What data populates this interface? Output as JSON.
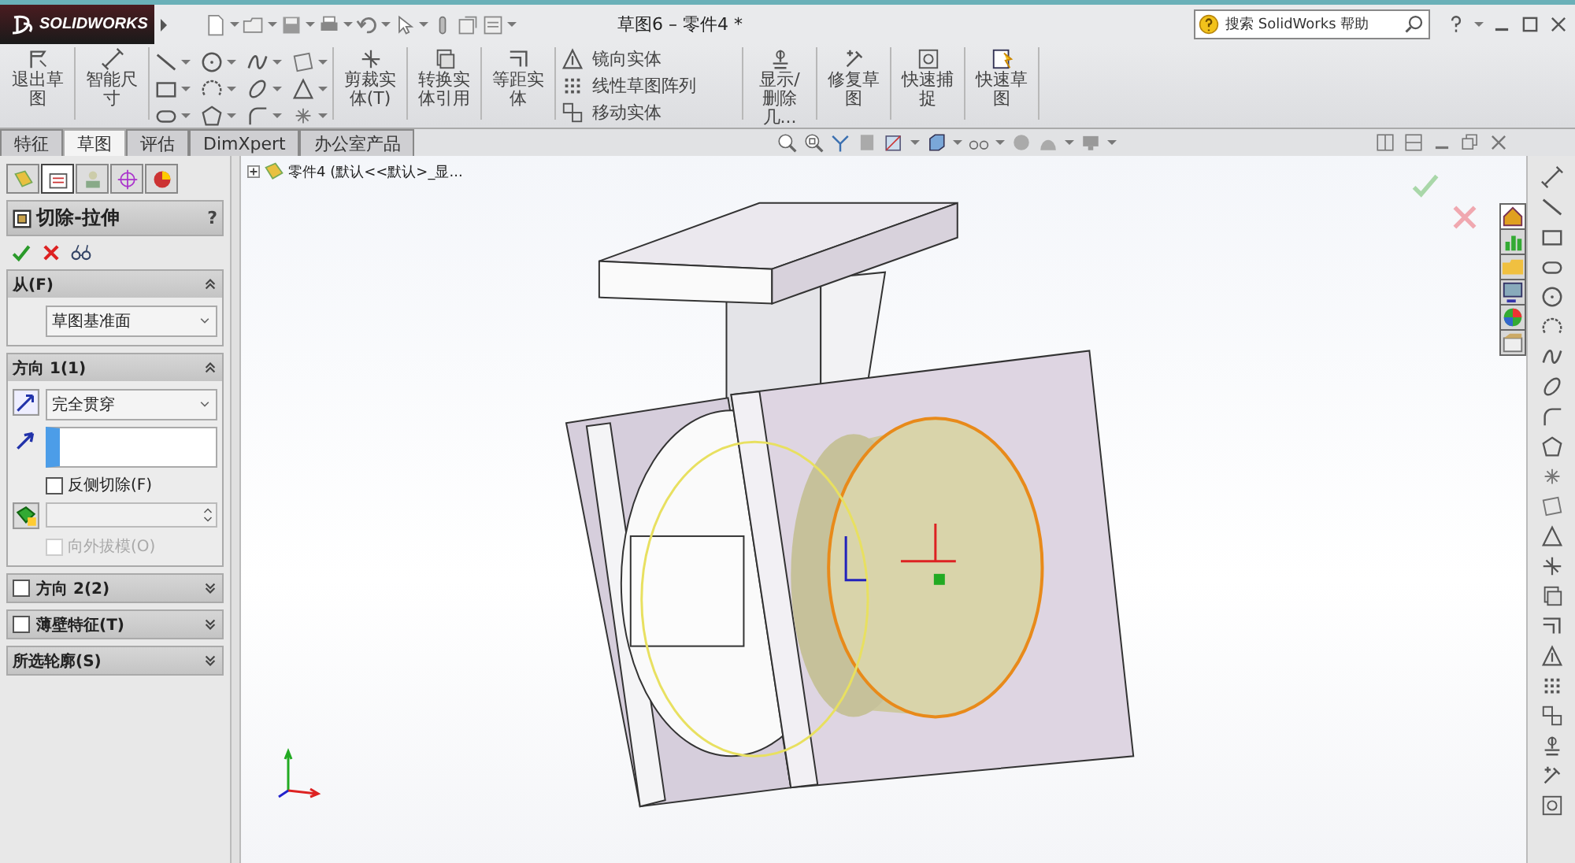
{
  "title_bar": {
    "brand": "SOLIDWORKS",
    "document_title": "草图6 – 零件4 *",
    "search": {
      "placeholder": "搜索 SolidWorks 帮助"
    }
  },
  "ribbon": [
    {
      "kind": "large",
      "label": "退出草图"
    },
    {
      "kind": "large",
      "label": "智能尺寸"
    },
    {
      "kind": "tools"
    },
    {
      "kind": "large",
      "label": "剪裁实体(T)"
    },
    {
      "kind": "large",
      "label": "转换实体引用"
    },
    {
      "kind": "large",
      "label": "等距实体"
    },
    {
      "kind": "list",
      "items": [
        {
          "label": "镜向实体"
        },
        {
          "label": "线性草图阵列"
        },
        {
          "label": "移动实体"
        }
      ]
    },
    {
      "kind": "large",
      "label": "显示/删除几..."
    },
    {
      "kind": "large",
      "label": "修复草图"
    },
    {
      "kind": "large",
      "label": "快速捕捉"
    },
    {
      "kind": "large",
      "label": "快速草图"
    }
  ],
  "tabs": [
    {
      "label": "特征",
      "selected": false
    },
    {
      "label": "草图",
      "selected": true
    },
    {
      "label": "评估",
      "selected": false
    },
    {
      "label": "DimXpert",
      "selected": false
    },
    {
      "label": "办公室产品",
      "selected": false
    }
  ],
  "panel_tabs": [
    {
      "selected": false
    },
    {
      "selected": true
    },
    {
      "selected": false
    },
    {
      "selected": false
    },
    {
      "selected": false
    }
  ],
  "feature_tree": {
    "label": "零件4 (默认<<默认>_显..."
  },
  "property_manager": {
    "title": "切除-拉伸",
    "help": "?",
    "sections": [
      {
        "title": "从(F)",
        "expanded": true,
        "fields": [
          {
            "kind": "dropdown",
            "value": "草图基准面"
          }
        ]
      },
      {
        "title": "方向 1(1)",
        "expanded": true,
        "fields": [
          {
            "kind": "dropdown",
            "value": "完全贯穿"
          },
          {
            "kind": "selection"
          },
          {
            "kind": "checkbox",
            "label": "反侧切除(F)",
            "checked": false,
            "disabled": false
          },
          {
            "kind": "spinner"
          },
          {
            "kind": "checkbox",
            "label": "向外拔模(O)",
            "checked": false,
            "disabled": true
          }
        ]
      },
      {
        "title": "方向 2(2)",
        "expanded": false,
        "checked": false
      },
      {
        "title": "薄壁特征(T)",
        "expanded": false,
        "checked": false
      },
      {
        "title": "所选轮廓(S)",
        "expanded": false
      }
    ]
  }
}
